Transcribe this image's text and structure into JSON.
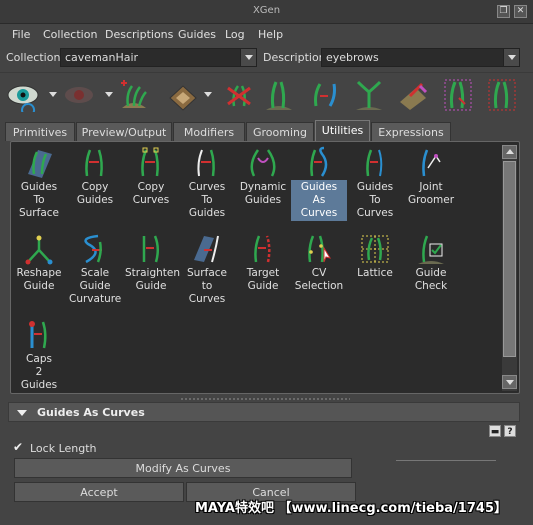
{
  "window": {
    "title": "XGen"
  },
  "menu": [
    "File",
    "Collection",
    "Descriptions",
    "Guides",
    "Log",
    "Help"
  ],
  "collection": {
    "label": "Collection",
    "value": "cavemanHair"
  },
  "description": {
    "label": "Description",
    "value": "eyebrows"
  },
  "toolbar_icons": [
    "visibility-eye-icon",
    "hidden-guides-icon",
    "add-description-icon",
    "create-patch-icon",
    "delete-description-icon",
    "add-guide-icon",
    "bend-guide-icon",
    "split-guide-icon",
    "paint-guide-icon",
    "fx-guide-icon",
    "cage-guide-icon"
  ],
  "tabs": [
    "Primitives",
    "Preview/Output",
    "Modifiers",
    "Grooming",
    "Utilities",
    "Expressions"
  ],
  "active_tab": "Utilities",
  "tools": [
    {
      "label": "Guides\nTo\nSurface",
      "icon": "guides-to-surface-icon"
    },
    {
      "label": "Copy\nGuides",
      "icon": "copy-guides-icon"
    },
    {
      "label": "Copy\nCurves",
      "icon": "copy-curves-icon"
    },
    {
      "label": "Curves\nTo\nGuides",
      "icon": "curves-to-guides-icon"
    },
    {
      "label": "Dynamic\nGuides",
      "icon": "dynamic-guides-icon"
    },
    {
      "label": "Guides\nAs\nCurves",
      "icon": "guides-as-curves-icon",
      "selected": true
    },
    {
      "label": "Guides\nTo\nCurves",
      "icon": "guides-to-curves-icon"
    },
    {
      "label": "Joint\nGroomer",
      "icon": "joint-groomer-icon"
    },
    {
      "label": "Reshape\nGuide",
      "icon": "reshape-guide-icon"
    },
    {
      "label": "Scale\nGuide\nCurvature",
      "icon": "scale-guide-curvature-icon"
    },
    {
      "label": "Straighten\nGuide",
      "icon": "straighten-guide-icon"
    },
    {
      "label": "Surface\nto\nCurves",
      "icon": "surface-to-curves-icon"
    },
    {
      "label": "Target\nGuide",
      "icon": "target-guide-icon"
    },
    {
      "label": "CV\nSelection",
      "icon": "cv-selection-icon"
    },
    {
      "label": "Lattice",
      "icon": "lattice-icon"
    },
    {
      "label": "Guide\nCheck",
      "icon": "guide-check-icon"
    },
    {
      "label": "Caps\n2\nGuides",
      "icon": "caps-2-guides-icon"
    }
  ],
  "section": {
    "title": "Guides As Curves"
  },
  "options": {
    "lock_length": {
      "label": "Lock Length",
      "checked": true
    },
    "help_label": "?",
    "modify_button": "Modify As Curves",
    "accept_button": "Accept",
    "cancel_button": "Cancel"
  },
  "watermark": "MAYA特效吧 【www.linecg.com/tieba/1745】",
  "colors": {
    "selected": "#5d7a99",
    "panel": "#2b2b2b",
    "guide_green": "#2fa84f",
    "guide_red": "#d03030"
  }
}
